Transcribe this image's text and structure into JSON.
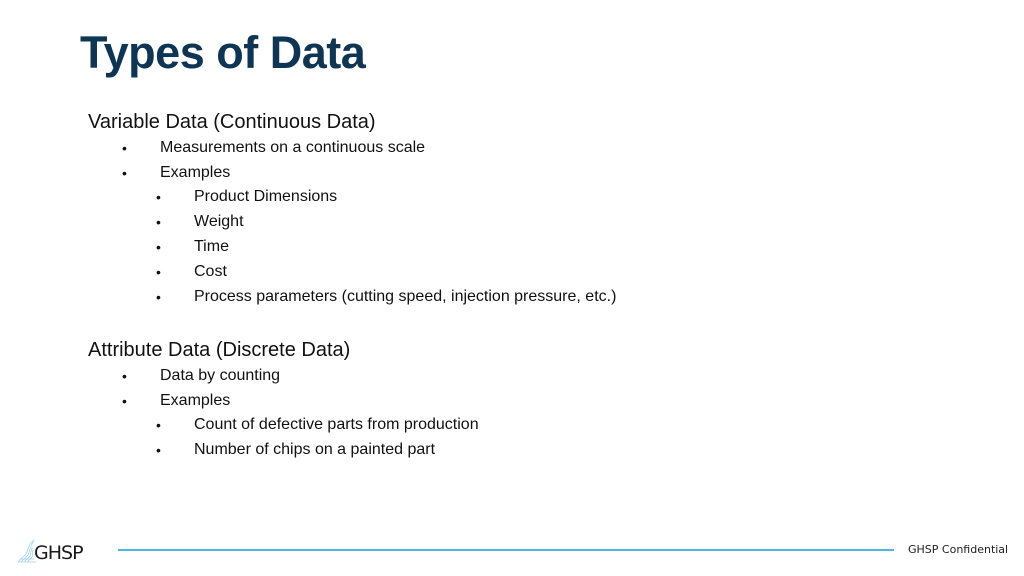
{
  "slide": {
    "title": "Types of Data",
    "sections": [
      {
        "heading": "Variable Data (Continuous Data)",
        "items": [
          {
            "text": "Measurements on a continuous scale",
            "level": 1
          },
          {
            "text": "Examples",
            "level": 1
          },
          {
            "text": "Product Dimensions",
            "level": 2
          },
          {
            "text": "Weight",
            "level": 2
          },
          {
            "text": "Time",
            "level": 2
          },
          {
            "text": "Cost",
            "level": 2
          },
          {
            "text": "Process parameters (cutting speed, injection pressure, etc.)",
            "level": 2
          }
        ]
      },
      {
        "heading": "Attribute Data (Discrete Data)",
        "items": [
          {
            "text": "Data by counting",
            "level": 1
          },
          {
            "text": "Examples",
            "level": 1
          },
          {
            "text": "Count of defective parts from production",
            "level": 2
          },
          {
            "text": "Number of chips on a painted part",
            "level": 2
          }
        ]
      }
    ],
    "bullet_glyph": "•"
  },
  "footer": {
    "logo_text": "GHSP",
    "confidential_label": "GHSP Confidential",
    "line_color": "#4db6e2"
  },
  "colors": {
    "title": "#0e3553",
    "body_text": "#111111"
  }
}
